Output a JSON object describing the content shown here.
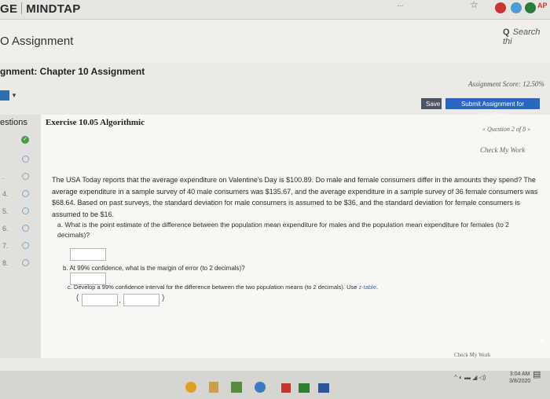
{
  "browser": {
    "brand_left": "GE",
    "brand_right": "MINDTAP",
    "url_fragment": "..."
  },
  "header": {
    "page_title": "O Assignment",
    "search_label": "Search thi",
    "assignment_title": "gnment: Chapter 10 Assignment",
    "score_label": "Assignment Score: 12.50%",
    "save_label": "Save",
    "submit_label": "Submit Assignment for Grading"
  },
  "sidebar": {
    "heading": "estions",
    "items": [
      {
        "num": "",
        "status": "correct"
      },
      {
        "num": "",
        "status": "open"
      },
      {
        "num": ".",
        "status": "open"
      },
      {
        "num": "4.",
        "status": "open"
      },
      {
        "num": "5.",
        "status": "open"
      },
      {
        "num": "6.",
        "status": "open"
      },
      {
        "num": "7.",
        "status": "open"
      },
      {
        "num": "8.",
        "status": "open"
      }
    ]
  },
  "exercise": {
    "heading": "Exercise 10.05 Algorithmic",
    "nav": "« Question 2 of 8 »",
    "check_my_work": "Check My Work",
    "problem_text": "The USA Today reports that the average expenditure on Valentine's Day is $100.89. Do male and female consumers differ in the amounts they spend? The average expenditure in a sample survey of 40 male consumers was $135.67, and the average expenditure in a sample survey of 36 female consumers was $68.64. Based on past surveys, the standard deviation for male consumers is assumed to be $36, and the standard deviation for female consumers is assumed to be $16.",
    "part_a": "a. What is the point estimate of the difference between the population mean expenditure for males and the population mean expenditure for females (to 2 decimals)?",
    "part_b": "b. At 99% confidence, what is the margin of error (to 2 decimals)?",
    "part_c_prefix": "c. Develop a 99% confidence interval for the difference between the two population means (to 2 decimals). Use",
    "part_c_link": "z-table",
    "part_c_suffix": ".",
    "check_my_work_bottom": "Check My Work"
  },
  "taskbar": {
    "time": "3:04 AM",
    "date": "3/8/2020"
  },
  "colors": {
    "accent_blue": "#2a67c2",
    "correct_green": "#4b9a4b",
    "save_gray": "#4b5563"
  }
}
